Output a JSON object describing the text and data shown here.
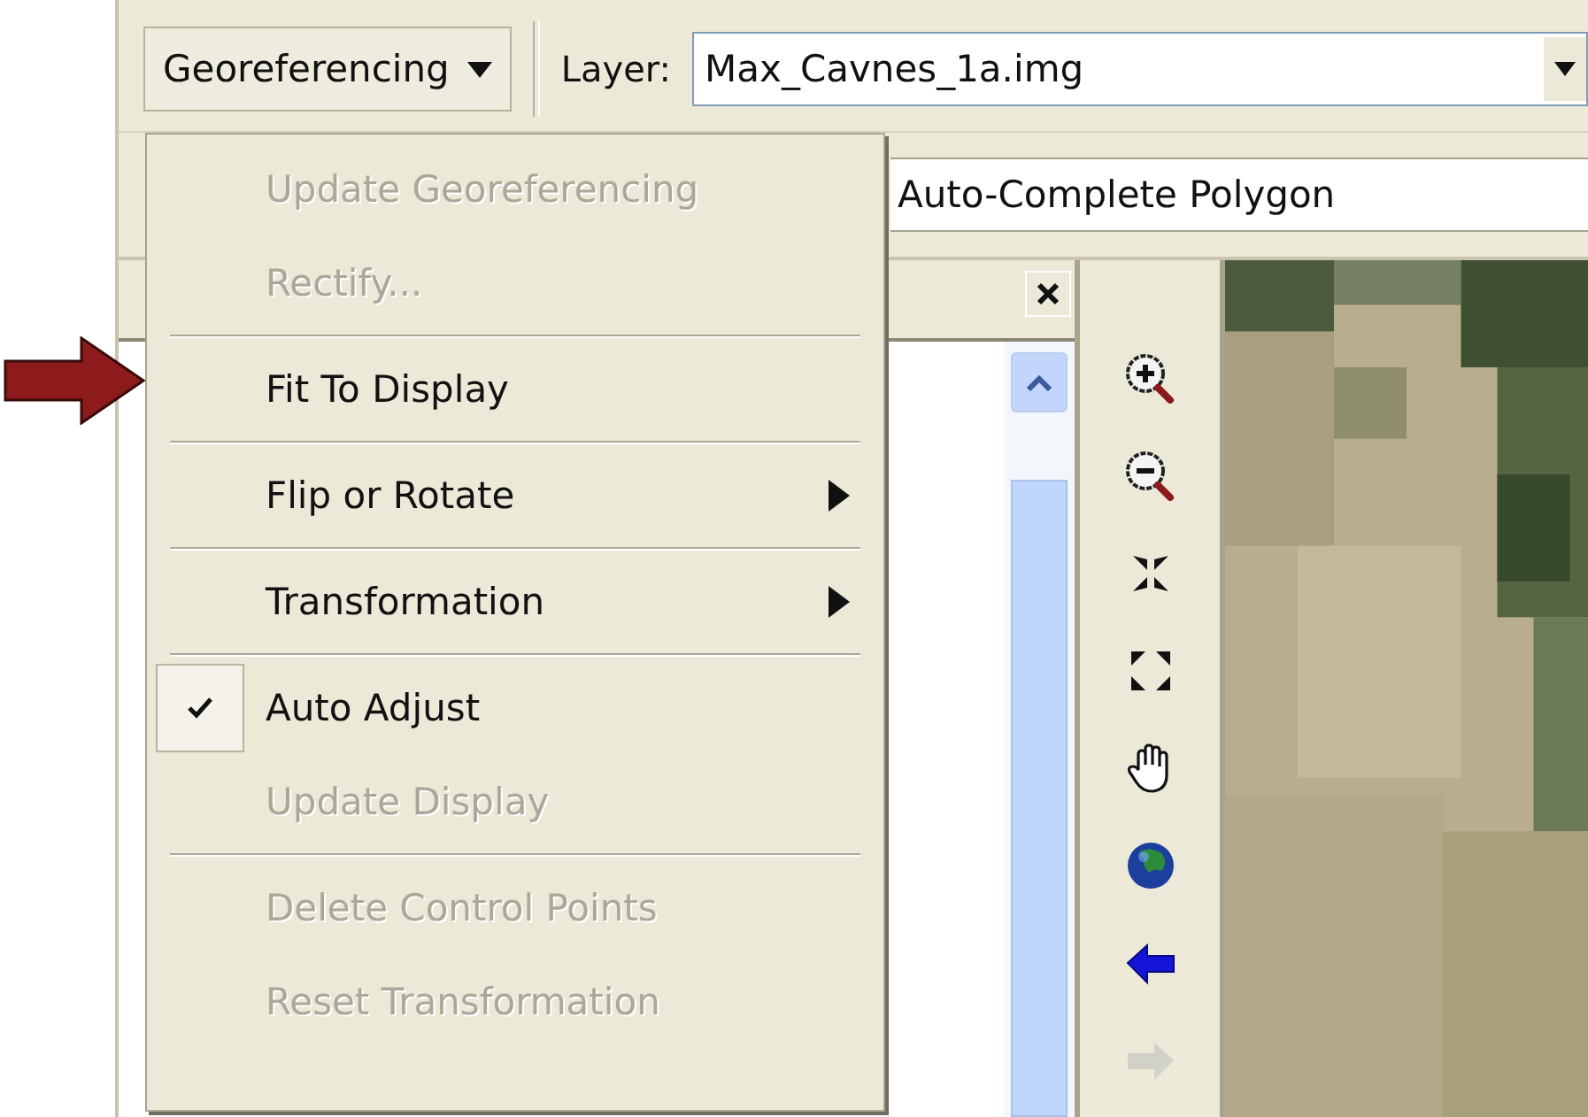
{
  "toolbar": {
    "menu_button": "Georeferencing",
    "layer_label": "Layer:",
    "layer_value": "Max_Cavnes_1a.img"
  },
  "second_toolbar": {
    "field_value": "Auto-Complete Polygon"
  },
  "menu": {
    "items": [
      {
        "kind": "item",
        "label": "Update Georeferencing",
        "disabled": true,
        "checked": false,
        "submenu": false
      },
      {
        "kind": "item",
        "label": "Rectify...",
        "disabled": true,
        "checked": false,
        "submenu": false
      },
      {
        "kind": "separator"
      },
      {
        "kind": "item",
        "label": "Fit To Display",
        "disabled": false,
        "checked": false,
        "submenu": false
      },
      {
        "kind": "separator"
      },
      {
        "kind": "item",
        "label": "Flip or Rotate",
        "disabled": false,
        "checked": false,
        "submenu": true
      },
      {
        "kind": "separator"
      },
      {
        "kind": "item",
        "label": "Transformation",
        "disabled": false,
        "checked": false,
        "submenu": true
      },
      {
        "kind": "separator"
      },
      {
        "kind": "item",
        "label": "Auto Adjust",
        "disabled": false,
        "checked": true,
        "submenu": false
      },
      {
        "kind": "item",
        "label": "Update Display",
        "disabled": true,
        "checked": false,
        "submenu": false
      },
      {
        "kind": "separator"
      },
      {
        "kind": "item",
        "label": "Delete Control Points",
        "disabled": true,
        "checked": false,
        "submenu": false
      },
      {
        "kind": "item",
        "label": "Reset Transformation",
        "disabled": true,
        "checked": false,
        "submenu": false
      }
    ]
  },
  "map_tools": [
    {
      "kind": "zoom-in",
      "disabled": false
    },
    {
      "kind": "zoom-out",
      "disabled": false
    },
    {
      "kind": "fixed-zoom-in",
      "disabled": false
    },
    {
      "kind": "fixed-zoom-out",
      "disabled": false
    },
    {
      "kind": "pan",
      "disabled": false
    },
    {
      "kind": "full-extent",
      "disabled": false
    },
    {
      "kind": "back",
      "disabled": false
    },
    {
      "kind": "forward",
      "disabled": true
    }
  ]
}
